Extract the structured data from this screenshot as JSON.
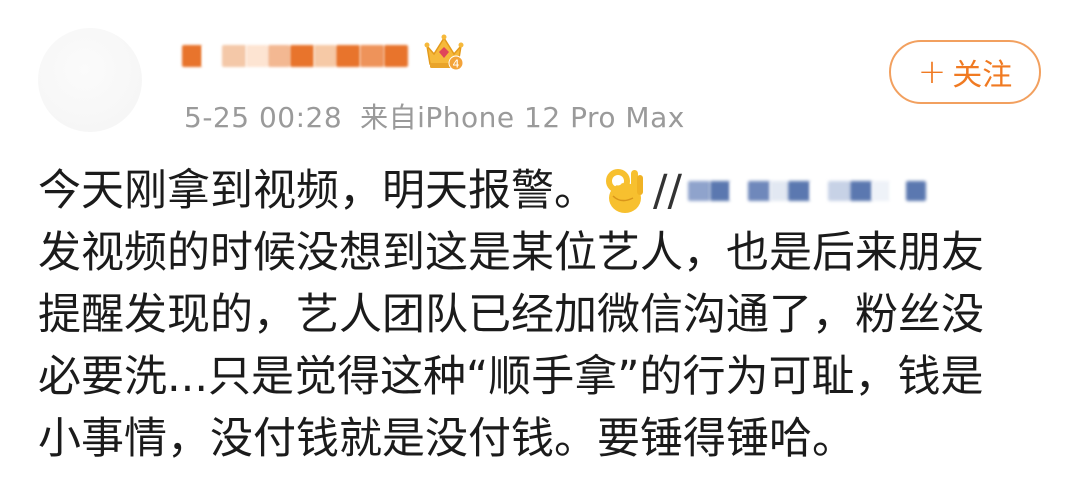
{
  "post": {
    "timestamp": "5-25 00:28",
    "source": "来自iPhone 12 Pro Max",
    "follow_label": "关注",
    "follow_plus": "+",
    "crown_badge_level": "4",
    "lines": {
      "l1_text": "今天刚拿到视频，明天报警。",
      "l1_slashes": "//",
      "l2": "发视频的时候没想到这是某位艺人，也是后来朋友",
      "l3": "提醒发现的，艺人团队已经加微信沟通了，粉丝没",
      "l4": "必要洗...只是觉得这种“顺手拿”的行为可耻，钱是",
      "l5": "小事情，没付钱就是没付钱。要锤得锤哈。"
    }
  },
  "icons": {
    "crown": "crown-badge-icon",
    "ok_hand": "ok-hand-emoji-icon"
  },
  "colors": {
    "accent_orange": "#f07a22",
    "follow_border": "#f2a05f",
    "timestamp_gray": "#9a9a9a",
    "mention_blue": "#5b78b0",
    "username_orange": "#e8742c"
  }
}
